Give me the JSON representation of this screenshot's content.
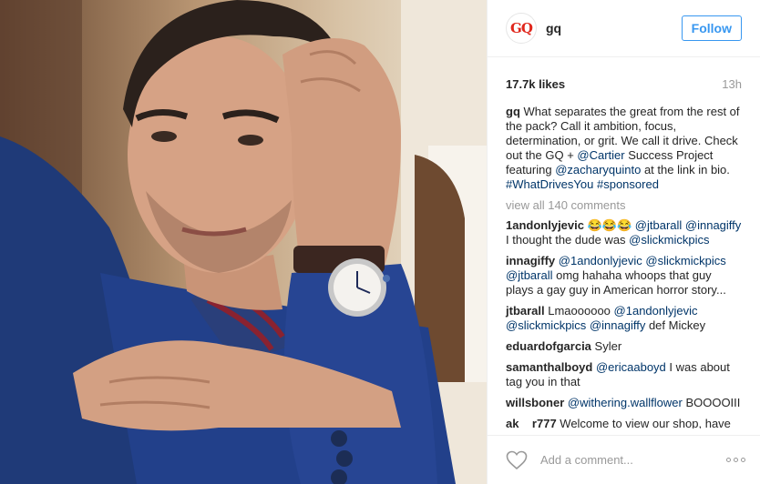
{
  "post": {
    "photo_icon": "man-with-watch-photo"
  },
  "header": {
    "logo_text": "GQ",
    "username": "gq",
    "follow_label": "Follow"
  },
  "meta": {
    "likes": "17.7k likes",
    "time": "13h"
  },
  "caption": {
    "author": "gq",
    "text_1": " What separates the great from the rest of the pack? Call it ambition, focus, determination, or grit. We call it drive. Check out the GQ + ",
    "link_1": "@Cartier",
    "text_2": " Success Project featuring ",
    "link_2": "@zacharyquinto",
    "text_3": " at the link in bio. ",
    "link_3": "#WhatDrivesYou",
    "text_4": " ",
    "link_4": "#sponsored"
  },
  "view_all": "view all 140 comments",
  "comments": [
    {
      "author": "1andonlyjevic",
      "t1": " 😂😂😂 ",
      "l1": "@jtbarall",
      "t2": " ",
      "l2": "@innagiffy",
      "t3": " I thought the dude was ",
      "l3": "@slickmickpics",
      "t4": ""
    },
    {
      "author": "innagiffy",
      "t1": " ",
      "l1": "@1andonlyjevic",
      "t2": " ",
      "l2": "@slickmickpics",
      "t3": " ",
      "l3": "@jtbarall",
      "t4": " omg hahaha whoops that guy plays a gay guy in American horror story..."
    },
    {
      "author": "jtbarall",
      "t1": " Lmaoooooo ",
      "l1": "@1andonlyjevic",
      "t2": " ",
      "l2": "@slickmickpics",
      "t3": " ",
      "l3": "@innagiffy",
      "t4": " def Mickey"
    },
    {
      "author": "eduardofgarcia",
      "t1": " Syler",
      "l1": "",
      "t2": "",
      "l2": "",
      "t3": "",
      "l3": "",
      "t4": ""
    },
    {
      "author": "samanthalboyd",
      "t1": " ",
      "l1": "@ericaaboyd",
      "t2": " I was about tag you in that",
      "l2": "",
      "t3": "",
      "l3": "",
      "t4": ""
    },
    {
      "author": "willsboner",
      "t1": " ",
      "l1": "@withering.wallflower",
      "t2": " BOOOOIII",
      "l2": "",
      "t3": "",
      "l3": "",
      "t4": ""
    },
    {
      "author": "ak__r777",
      "t1": " Welcome to view our shop, have",
      "l1": "",
      "t2": "",
      "l2": "",
      "t3": "",
      "l3": "",
      "t4": ""
    }
  ],
  "footer": {
    "like_icon": "heart-icon",
    "placeholder": "Add a comment...",
    "more_icon": "more-options-icon"
  },
  "colors": {
    "link": "#003569",
    "follow_blue": "#3897f0",
    "logo_red": "#e0261b"
  }
}
